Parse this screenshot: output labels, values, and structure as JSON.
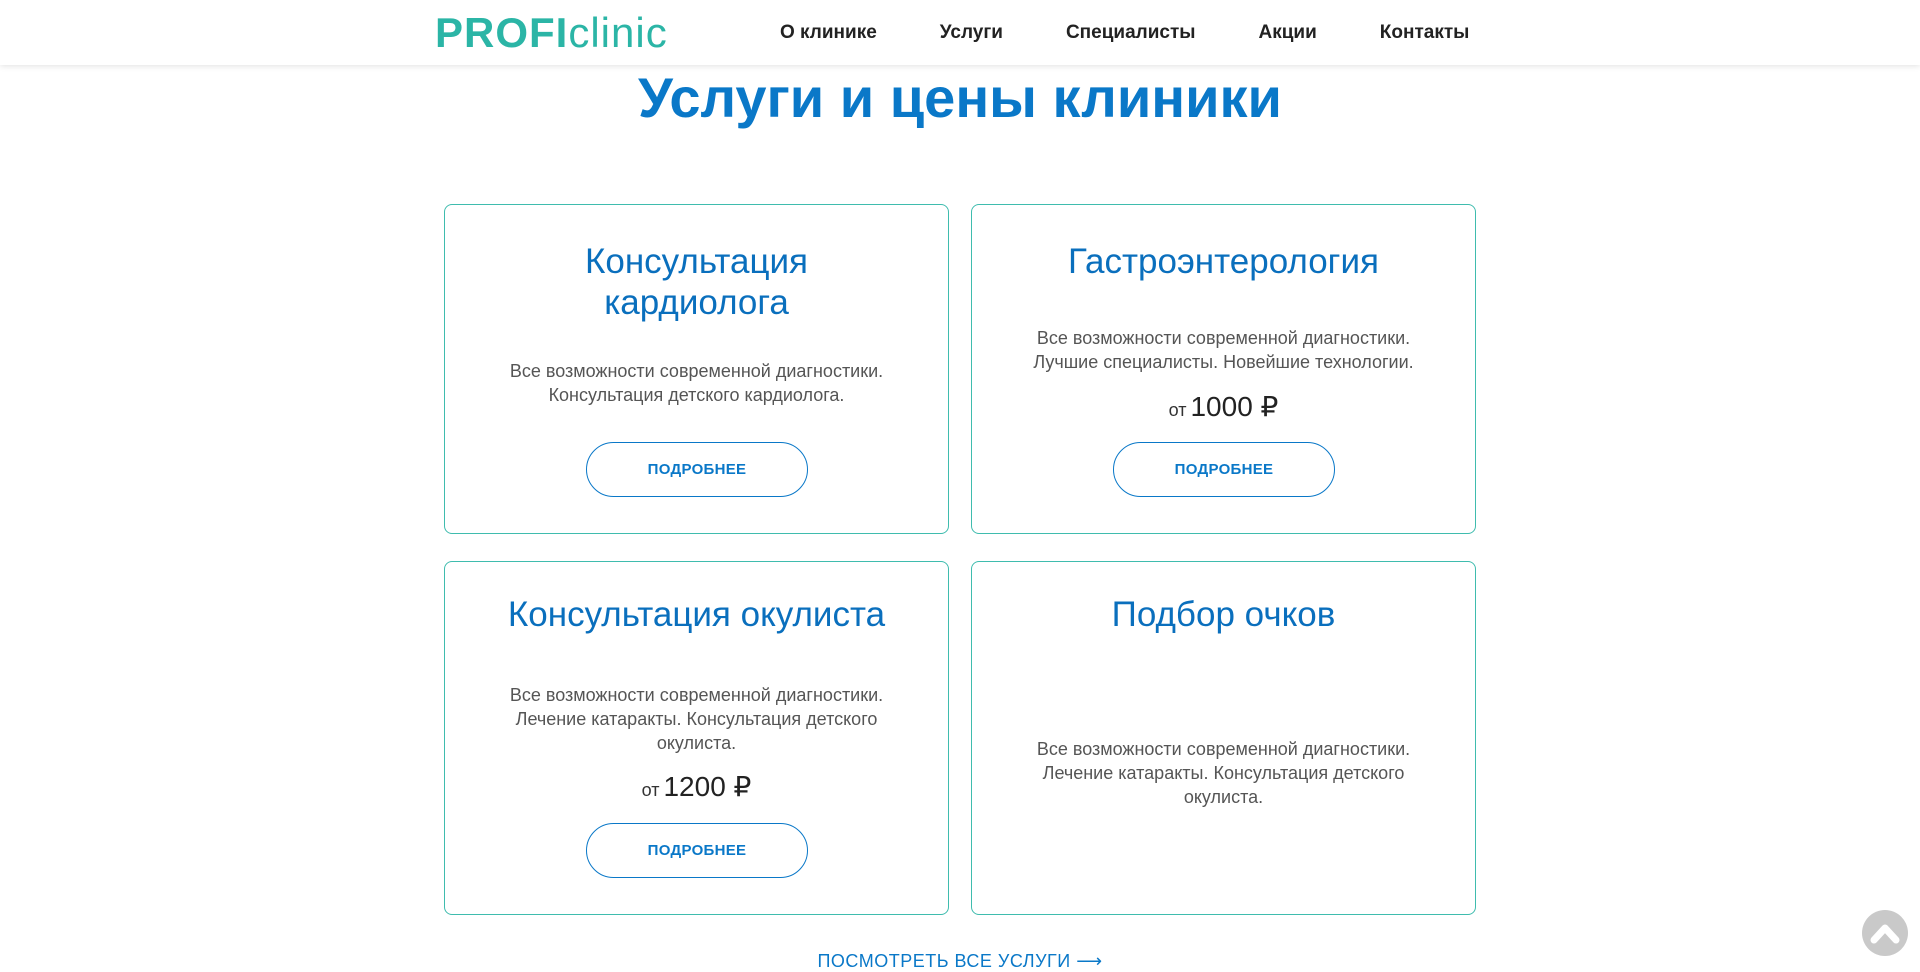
{
  "header": {
    "logo": {
      "part1": "PROFI",
      "part2": "clinic"
    },
    "nav": [
      "О клинике",
      "Услуги",
      "Специалисты",
      "Акции",
      "Контакты"
    ]
  },
  "page_title": "Услуги и цены клиники",
  "cards": [
    {
      "title": "Консультация кардиолога",
      "description": "Все возможности современной диагностики. Консультация детского кардиолога.",
      "price_prefix": "",
      "price": "",
      "button": "Подробнее"
    },
    {
      "title": "Гастроэнтерология",
      "description": "Все возможности современной диагностики. Лучшие специалисты. Новейшие технологии.",
      "price_prefix": "от",
      "price": "1000 ₽",
      "button": "Подробнее"
    },
    {
      "title": "Консультация окулиста",
      "description": "Все возможности современной диагностики. Лечение катаракты. Консультация детского окулиста.",
      "price_prefix": "от",
      "price": "1200 ₽",
      "button": "Подробнее"
    },
    {
      "title": "Подбор очков",
      "description": "Все возможности современной диагностики. Лечение катаракты. Консультация детского окулиста.",
      "price_prefix": "",
      "price": "",
      "button": ""
    }
  ],
  "all_services_link": "Посмотреть все услуги ⟶",
  "icons": {
    "scroll_top": "chevron-up-icon"
  },
  "colors": {
    "accent": "#0a78c8",
    "brand_teal": "#2bb5a6",
    "card_border": "#3fbcae"
  }
}
